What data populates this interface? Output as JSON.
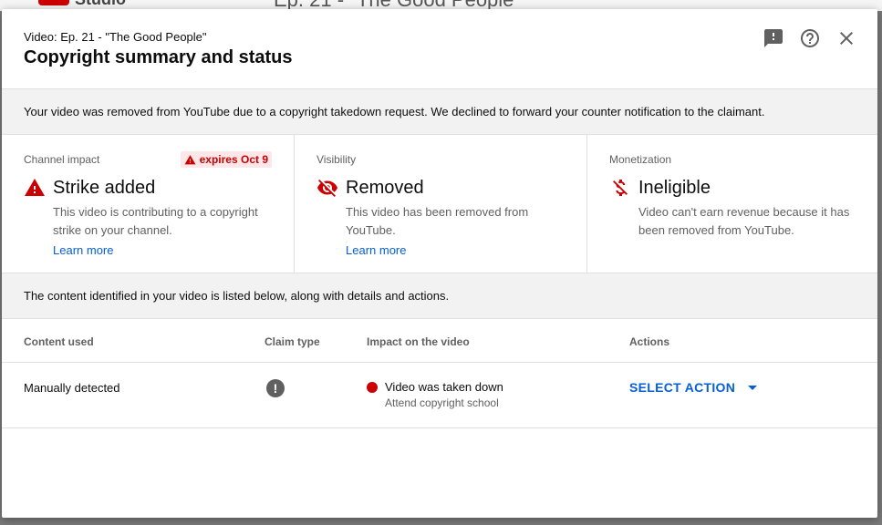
{
  "modal": {
    "subtitle": "Video: Ep. 21 - \"The Good People\"",
    "title": "Copyright summary and status"
  },
  "background": {
    "app": "Studio",
    "video_title": "Ep. 21 - \"The Good People\""
  },
  "banner": {
    "text": "Your video was removed from YouTube due to a copyright takedown request. We declined to forward your counter notification to the claimant."
  },
  "cards": [
    {
      "label": "Channel impact",
      "badge": "expires Oct 9",
      "value": "Strike added",
      "icon": "warning-icon",
      "description": "This video is contributing to a copyright strike on your channel.",
      "link": "Learn more"
    },
    {
      "label": "Visibility",
      "value": "Removed",
      "icon": "visibility-off-icon",
      "description": "This video has been removed from YouTube.",
      "link": "Learn more"
    },
    {
      "label": "Monetization",
      "value": "Ineligible",
      "icon": "money-off-icon",
      "description": "Video can't earn revenue because it has been removed from YouTube."
    }
  ],
  "section": {
    "text": "The content identified in your video is listed below, along with details and actions."
  },
  "table": {
    "headers": [
      "Content used",
      "Claim type",
      "Impact on the video",
      "Actions"
    ],
    "rows": [
      {
        "content": "Manually detected",
        "claim_type_icon": "exclamation-icon",
        "impact_main": "Video was taken down",
        "impact_sub": "Attend copyright school",
        "action": "SELECT ACTION"
      }
    ]
  },
  "colors": {
    "accent": "#065fd4",
    "danger": "#cc0000",
    "muted": "#606060"
  }
}
